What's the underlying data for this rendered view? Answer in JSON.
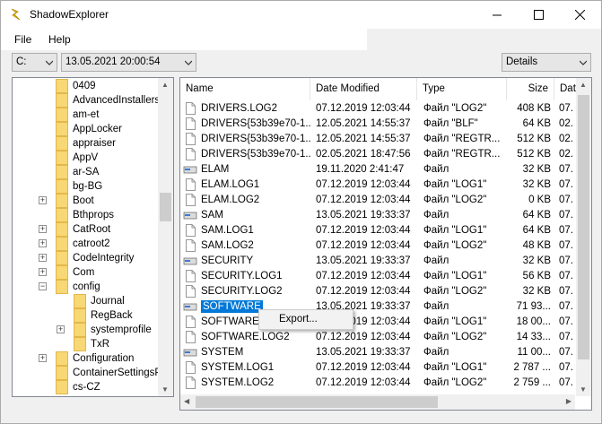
{
  "app": {
    "title": "ShadowExplorer"
  },
  "menu": {
    "file": "File",
    "help": "Help"
  },
  "toolbar": {
    "drive": "C:",
    "snapshot": "13.05.2021 20:00:54",
    "view": "Details"
  },
  "tree": [
    {
      "label": "0409",
      "indent": 0,
      "expander": false
    },
    {
      "label": "AdvancedInstallers",
      "indent": 0,
      "expander": false
    },
    {
      "label": "am-et",
      "indent": 0,
      "expander": false
    },
    {
      "label": "AppLocker",
      "indent": 0,
      "expander": false
    },
    {
      "label": "appraiser",
      "indent": 0,
      "expander": false
    },
    {
      "label": "AppV",
      "indent": 0,
      "expander": false
    },
    {
      "label": "ar-SA",
      "indent": 0,
      "expander": false
    },
    {
      "label": "bg-BG",
      "indent": 0,
      "expander": false
    },
    {
      "label": "Boot",
      "indent": 0,
      "expander": true,
      "state": "+"
    },
    {
      "label": "Bthprops",
      "indent": 0,
      "expander": false
    },
    {
      "label": "CatRoot",
      "indent": 0,
      "expander": true,
      "state": "+"
    },
    {
      "label": "catroot2",
      "indent": 0,
      "expander": true,
      "state": "+"
    },
    {
      "label": "CodeIntegrity",
      "indent": 0,
      "expander": true,
      "state": "+"
    },
    {
      "label": "Com",
      "indent": 0,
      "expander": true,
      "state": "+"
    },
    {
      "label": "config",
      "indent": 0,
      "expander": true,
      "state": "−"
    },
    {
      "label": "Journal",
      "indent": 1,
      "expander": false
    },
    {
      "label": "RegBack",
      "indent": 1,
      "expander": false
    },
    {
      "label": "systemprofile",
      "indent": 1,
      "expander": true,
      "state": "+"
    },
    {
      "label": "TxR",
      "indent": 1,
      "expander": false
    },
    {
      "label": "Configuration",
      "indent": 0,
      "expander": true,
      "state": "+"
    },
    {
      "label": "ContainerSettingsPro",
      "indent": 0,
      "expander": false
    },
    {
      "label": "cs-CZ",
      "indent": 0,
      "expander": false
    }
  ],
  "columns": [
    "Name",
    "Date Modified",
    "Type",
    "Size",
    "Date"
  ],
  "files": [
    {
      "name": "DRIVERS.LOG2",
      "date": "07.12.2019 12:03:44",
      "type": "Файл \"LOG2\"",
      "size": "408 KB",
      "date2": "07.",
      "icon": "file"
    },
    {
      "name": "DRIVERS{53b39e70-1...",
      "date": "12.05.2021 14:55:37",
      "type": "Файл \"BLF\"",
      "size": "64 KB",
      "date2": "02.",
      "icon": "file"
    },
    {
      "name": "DRIVERS{53b39e70-1...",
      "date": "12.05.2021 14:55:37",
      "type": "Файл \"REGTR...",
      "size": "512 KB",
      "date2": "02.",
      "icon": "file"
    },
    {
      "name": "DRIVERS{53b39e70-1...",
      "date": "02.05.2021 18:47:56",
      "type": "Файл \"REGTR...",
      "size": "512 KB",
      "date2": "02.",
      "icon": "file"
    },
    {
      "name": "ELAM",
      "date": "19.11.2020 2:41:47",
      "type": "Файл",
      "size": "32 KB",
      "date2": "07.",
      "icon": "drive"
    },
    {
      "name": "ELAM.LOG1",
      "date": "07.12.2019 12:03:44",
      "type": "Файл \"LOG1\"",
      "size": "32 KB",
      "date2": "07.",
      "icon": "file"
    },
    {
      "name": "ELAM.LOG2",
      "date": "07.12.2019 12:03:44",
      "type": "Файл \"LOG2\"",
      "size": "0 KB",
      "date2": "07.",
      "icon": "file"
    },
    {
      "name": "SAM",
      "date": "13.05.2021 19:33:37",
      "type": "Файл",
      "size": "64 KB",
      "date2": "07.",
      "icon": "drive"
    },
    {
      "name": "SAM.LOG1",
      "date": "07.12.2019 12:03:44",
      "type": "Файл \"LOG1\"",
      "size": "64 KB",
      "date2": "07.",
      "icon": "file"
    },
    {
      "name": "SAM.LOG2",
      "date": "07.12.2019 12:03:44",
      "type": "Файл \"LOG2\"",
      "size": "48 KB",
      "date2": "07.",
      "icon": "file"
    },
    {
      "name": "SECURITY",
      "date": "13.05.2021 19:33:37",
      "type": "Файл",
      "size": "32 KB",
      "date2": "07.",
      "icon": "drive"
    },
    {
      "name": "SECURITY.LOG1",
      "date": "07.12.2019 12:03:44",
      "type": "Файл \"LOG1\"",
      "size": "56 KB",
      "date2": "07.",
      "icon": "file"
    },
    {
      "name": "SECURITY.LOG2",
      "date": "07.12.2019 12:03:44",
      "type": "Файл \"LOG2\"",
      "size": "32 KB",
      "date2": "07.",
      "icon": "file"
    },
    {
      "name": "SOFTWARE",
      "date": "13.05.2021 19:33:37",
      "type": "Файл",
      "size": "71 93...",
      "date2": "07.",
      "icon": "drive",
      "selected": true
    },
    {
      "name": "SOFTWARE",
      "date": "07.12.2019 12:03:44",
      "type": "Файл \"LOG1\"",
      "size": "18 00...",
      "date2": "07.",
      "icon": "file"
    },
    {
      "name": "SOFTWARE.LOG2",
      "date": "07.12.2019 12:03:44",
      "type": "Файл \"LOG2\"",
      "size": "14 33...",
      "date2": "07.",
      "icon": "file"
    },
    {
      "name": "SYSTEM",
      "date": "13.05.2021 19:33:37",
      "type": "Файл",
      "size": "11 00...",
      "date2": "07.",
      "icon": "drive"
    },
    {
      "name": "SYSTEM.LOG1",
      "date": "07.12.2019 12:03:44",
      "type": "Файл \"LOG1\"",
      "size": "2 787 ...",
      "date2": "07.",
      "icon": "file"
    },
    {
      "name": "SYSTEM.LOG2",
      "date": "07.12.2019 12:03:44",
      "type": "Файл \"LOG2\"",
      "size": "2 759 ...",
      "date2": "07.",
      "icon": "file"
    }
  ],
  "context_menu": {
    "export": "Export..."
  }
}
